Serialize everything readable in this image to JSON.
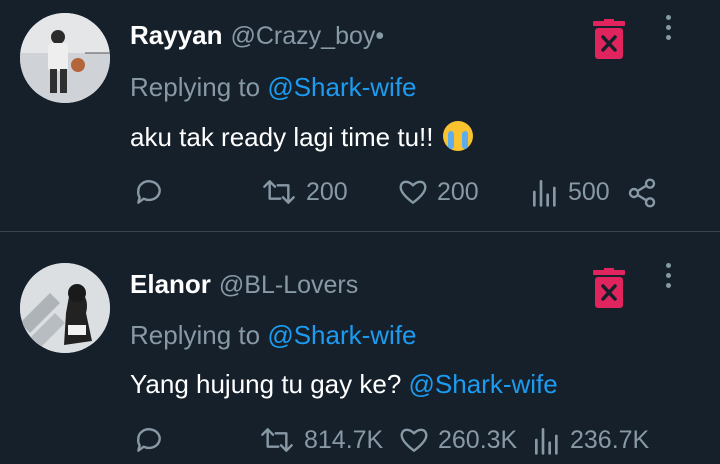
{
  "tweets": [
    {
      "name": "Rayyan",
      "handle": "@Crazy_boy•",
      "replying_prefix": "Replying to",
      "replying_to": "@Shark-wife",
      "text": "aku tak ready lagi time tu!!",
      "emoji": "loudly-crying-face",
      "retweets": "200",
      "likes": "200",
      "views": "500"
    },
    {
      "name": "Elanor",
      "handle": "@BL-Lovers",
      "replying_prefix": "Replying to",
      "replying_to": "@Shark-wife",
      "text": "Yang hujung tu gay ke?",
      "text_mention": "@Shark-wife",
      "retweets": "814.7K",
      "likes": "260.3K",
      "views": "236.7K"
    }
  ],
  "colors": {
    "background": "#15202b",
    "muted": "#8899a6",
    "accent": "#1d9bf0",
    "delete": "#e0245e"
  }
}
